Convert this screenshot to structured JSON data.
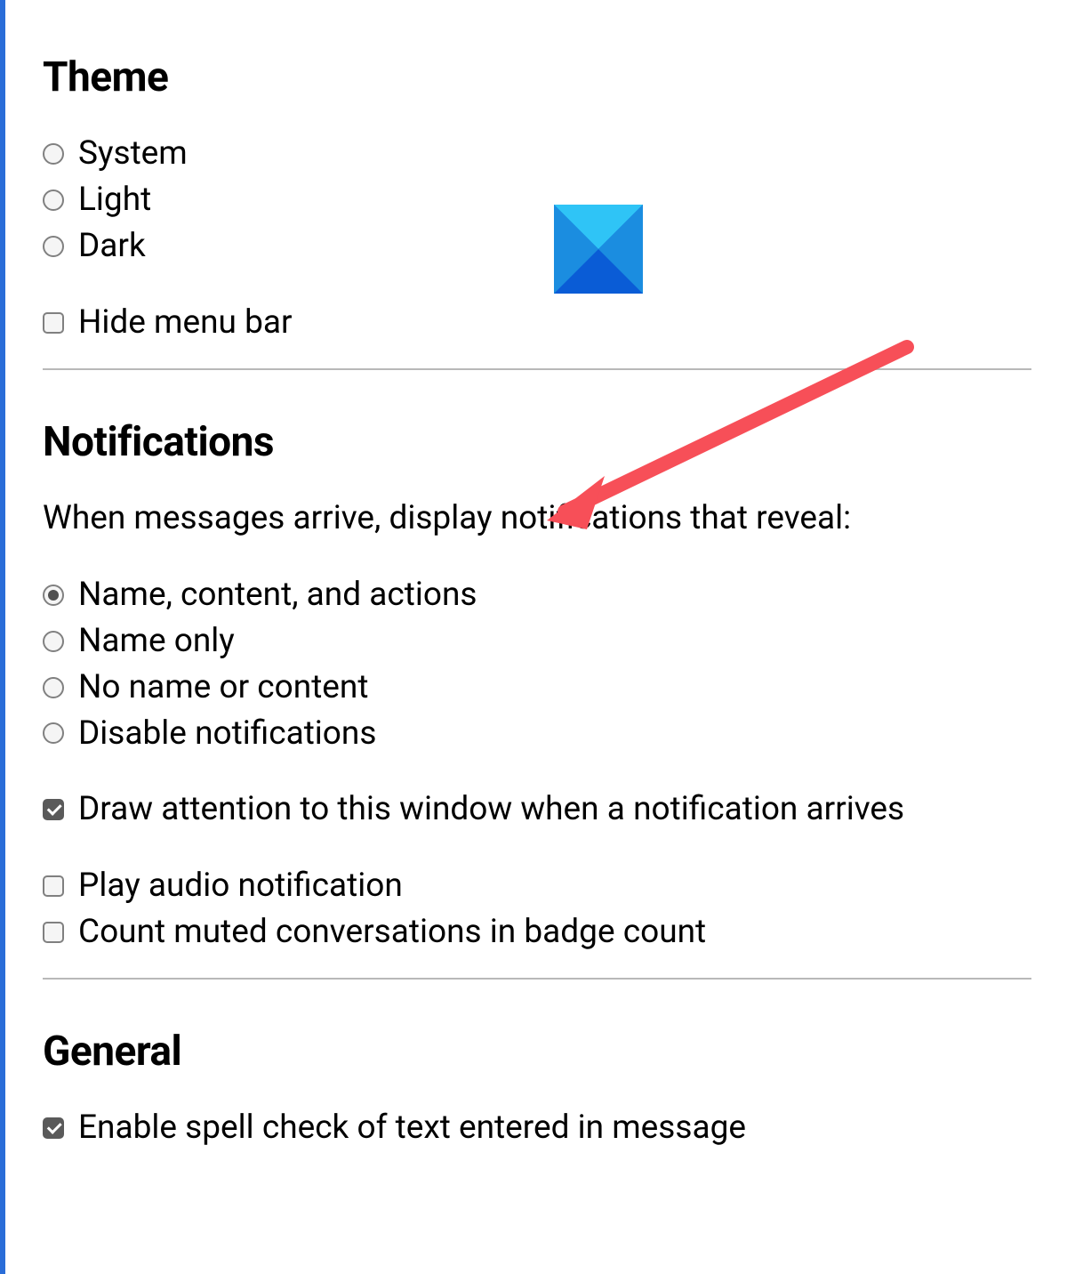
{
  "theme": {
    "title": "Theme",
    "options": [
      {
        "label": "System",
        "selected": false
      },
      {
        "label": "Light",
        "selected": false
      },
      {
        "label": "Dark",
        "selected": false
      }
    ],
    "hide_menu_bar": {
      "label": "Hide menu bar",
      "checked": false
    }
  },
  "notifications": {
    "title": "Notifications",
    "intro": "When messages arrive, display notifications that reveal:",
    "options": [
      {
        "label": "Name, content, and actions",
        "selected": true
      },
      {
        "label": "Name only",
        "selected": false
      },
      {
        "label": "No name or content",
        "selected": false
      },
      {
        "label": "Disable notifications",
        "selected": false
      }
    ],
    "draw_attention": {
      "label": "Draw attention to this window when a notification arrives",
      "checked": true
    },
    "play_audio": {
      "label": "Play audio notification",
      "checked": false
    },
    "count_muted": {
      "label": "Count muted conversations in badge count",
      "checked": false
    }
  },
  "general": {
    "title": "General",
    "spell_check": {
      "label": "Enable spell check of text entered in message",
      "checked": true
    }
  },
  "annotation": {
    "arrow_color": "#f74f58"
  }
}
